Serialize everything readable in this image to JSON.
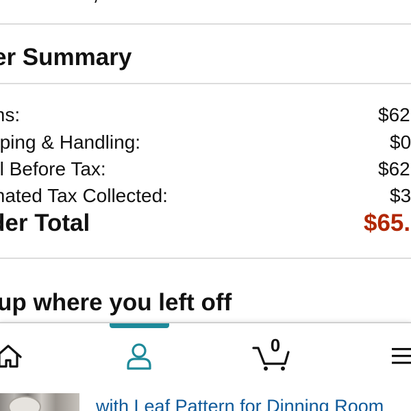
{
  "order_summary": {
    "title": "er Summary",
    "rows": [
      {
        "label": "ms:",
        "value": "$62"
      },
      {
        "label": "pping & Handling:",
        "value": "$0"
      },
      {
        "label": "al Before Tax:",
        "value": "$62"
      },
      {
        "label": "mated Tax Collected:",
        "value": "$3"
      }
    ],
    "total": {
      "label": "der Total",
      "value": "$65."
    }
  },
  "continue_section": {
    "title": "up where you left off"
  },
  "nav": {
    "items": [
      {
        "name": "home",
        "icon": "home-icon"
      },
      {
        "name": "account",
        "icon": "person-icon",
        "active": true
      },
      {
        "name": "cart",
        "icon": "cart-icon"
      },
      {
        "name": "menu",
        "icon": "menu-icon"
      }
    ],
    "cart_count": "0",
    "accent_color": "#1e8a9a"
  },
  "product_preview": {
    "title": "with Leaf Pattern for Dinning Room"
  },
  "colors": {
    "total_price": "#b12704",
    "link": "#0f5a9a",
    "divider": "#dcdcdc"
  }
}
